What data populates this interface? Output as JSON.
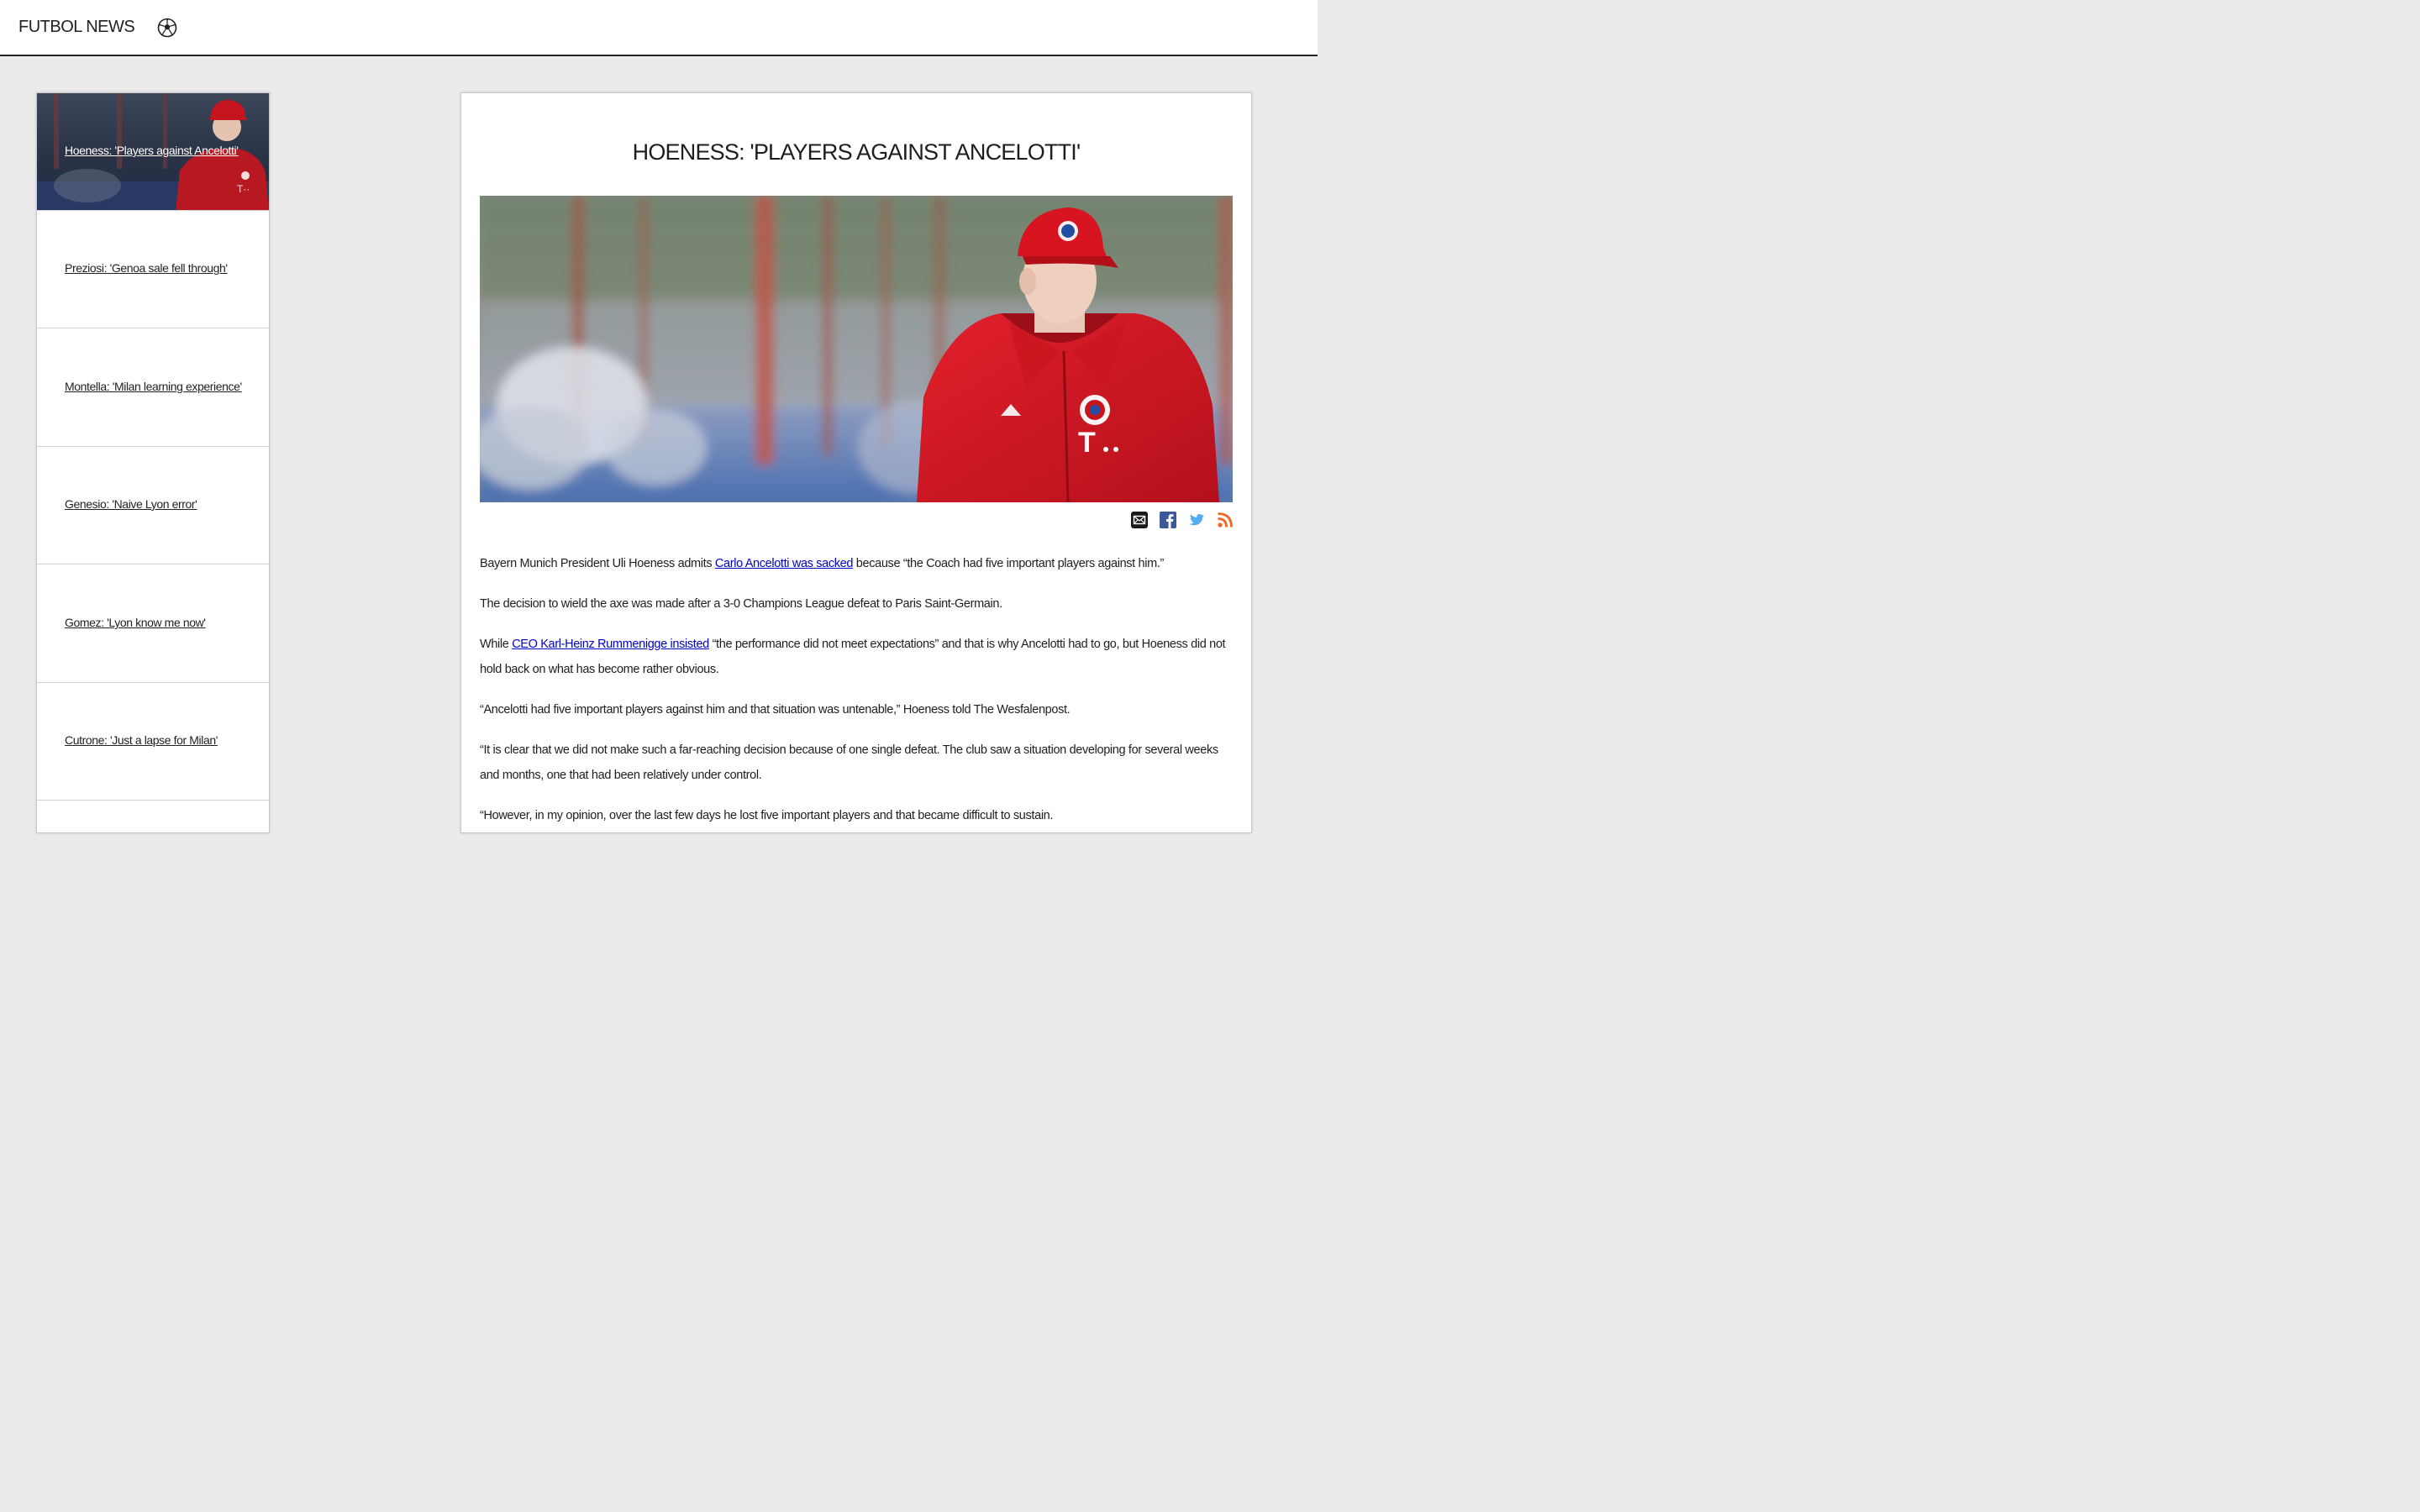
{
  "header": {
    "site_title": "FUTBOL NEWS",
    "logo_icon": "soccer-ball-icon"
  },
  "sidebar": {
    "items": [
      {
        "label": "Hoeness: 'Players against Ancelotti'",
        "featured": true
      },
      {
        "label": "Preziosi: 'Genoa sale fell through'"
      },
      {
        "label": "Montella: 'Milan learning experience'"
      },
      {
        "label": "Genesio: 'Naive Lyon error'"
      },
      {
        "label": "Gomez: 'Lyon know me now'"
      },
      {
        "label": "Cutrone: 'Just a lapse for Milan'"
      }
    ]
  },
  "article": {
    "title": "HOENESS: 'PLAYERS AGAINST ANCELOTTI'",
    "share_icons": [
      "email-icon",
      "facebook-icon",
      "twitter-icon",
      "rss-icon"
    ],
    "colors": {
      "link": "#0000cc",
      "facebook": "#3b5998",
      "twitter": "#55acee",
      "rss": "#f26522",
      "jacket_red": "#d7141f"
    },
    "p1": {
      "before": "Bayern Munich President Uli Hoeness admits ",
      "link": "Carlo Ancelotti was sacked",
      "after": " because “the Coach had five important players against him.”"
    },
    "p2": "The decision to wield the axe was made after a 3-0 Champions League defeat to Paris Saint-Germain.",
    "p3": {
      "before": "While ",
      "link": "CEO Karl-Heinz Rummenigge insisted",
      "after": " “the performance did not meet expectations” and that is why Ancelotti had to go, but Hoeness did not hold back on what has become rather obvious."
    },
    "p4": "“Ancelotti had five important players against him and that situation was untenable,” Hoeness told The Wesfalenpost.",
    "p5": "“It is clear that we did not make such a far-reaching decision because of one single defeat. The club saw a situation developing for several weeks and months, one that had been relatively under control.",
    "p6": "“However, in my opinion, over the last few days he lost five important players and that became difficult to sustain."
  }
}
